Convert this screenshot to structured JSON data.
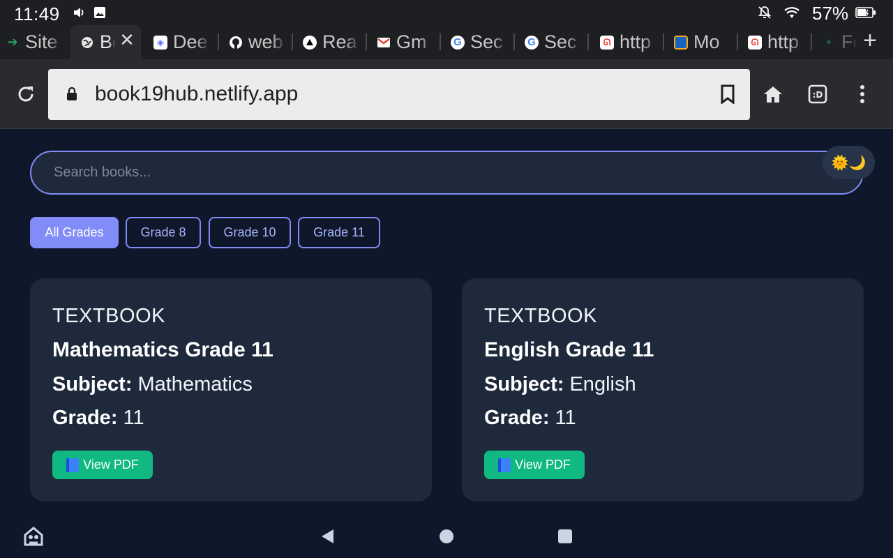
{
  "status_bar": {
    "time": "11:49",
    "battery_percent": "57%",
    "icons": [
      "volume-icon",
      "image-icon",
      "bell-off-icon",
      "wifi-icon",
      "battery-icon"
    ]
  },
  "tabs": [
    {
      "label": "Site",
      "favicon": "arrow-icon",
      "color": "#2fa36b",
      "active": false
    },
    {
      "label": "Book",
      "favicon": "globe-icon",
      "color": "#e8e8e8",
      "active": true
    },
    {
      "label": "Dee",
      "favicon": "deepseek-icon",
      "color": "#4d6bfe",
      "active": false
    },
    {
      "label": "web",
      "favicon": "github-icon",
      "color": "#ffffff",
      "active": false
    },
    {
      "label": "Rea",
      "favicon": "triangle-icon",
      "color": "#000000",
      "active": false
    },
    {
      "label": "Gm",
      "favicon": "gmail-icon",
      "color": "#ea4335",
      "active": false
    },
    {
      "label": "Sec",
      "favicon": "google-icon",
      "color": "#4285f4",
      "active": false
    },
    {
      "label": "Sec",
      "favicon": "google-icon",
      "color": "#4285f4",
      "active": false
    },
    {
      "label": "http",
      "favicon": "site-icon",
      "color": "#e53935",
      "active": false
    },
    {
      "label": "Mo",
      "favicon": "site-icon",
      "color": "#1565c0",
      "active": false
    },
    {
      "label": "http",
      "favicon": "site-icon",
      "color": "#e53935",
      "active": false
    },
    {
      "label": "Fe",
      "favicon": "site-icon",
      "color": "#26a69a",
      "active": false
    }
  ],
  "toolbar": {
    "url": "book19hub.netlify.app"
  },
  "page": {
    "search_placeholder": "Search books...",
    "theme_toggle": "🌞🌙",
    "filters": [
      {
        "label": "All Grades",
        "active": true
      },
      {
        "label": "Grade 8",
        "active": false
      },
      {
        "label": "Grade 10",
        "active": false
      },
      {
        "label": "Grade 11",
        "active": false
      }
    ],
    "books": [
      {
        "type": "TEXTBOOK",
        "title": "Mathematics Grade 11",
        "subject_label": "Subject:",
        "subject": "Mathematics",
        "grade_label": "Grade:",
        "grade": "11",
        "button": "View PDF"
      },
      {
        "type": "TEXTBOOK",
        "title": "English Grade 11",
        "subject_label": "Subject:",
        "subject": "English",
        "grade_label": "Grade:",
        "grade": "11",
        "button": "View PDF"
      }
    ]
  },
  "colors": {
    "background": "#0f172a",
    "card": "#1e293b",
    "accent": "#818cf8",
    "button_green": "#10b981"
  }
}
